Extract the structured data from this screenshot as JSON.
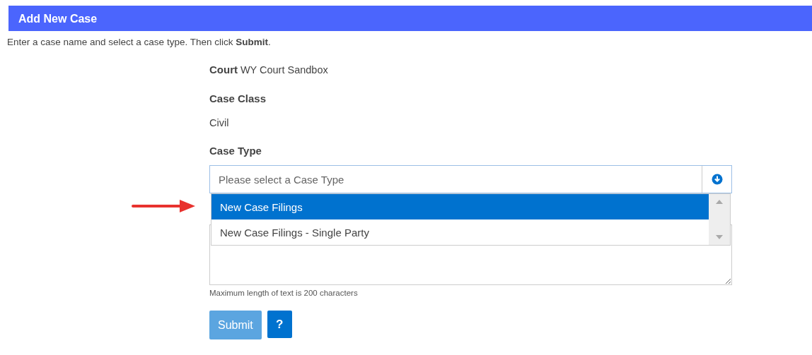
{
  "header": {
    "title": "Add New Case"
  },
  "instructions": "Enter a case name and select a case type. Then click **Submit**.",
  "court": {
    "label": "Court",
    "value": "WY Court Sandbox"
  },
  "case_class": {
    "label": "Case Class",
    "value": "Civil"
  },
  "case_type": {
    "label": "Case Type",
    "placeholder": "Please select a Case Type",
    "expanded": true,
    "options": [
      {
        "label": "New Case Filings",
        "selected": true
      },
      {
        "label": "New Case Filings - Single Party",
        "selected": false
      }
    ]
  },
  "case_name": {
    "hint": "Maximum length of text is 200 characters"
  },
  "buttons": [
    {
      "kind": "submit",
      "label": "Submit",
      "disabled": true
    },
    {
      "kind": "help",
      "label": "?",
      "disabled": false
    }
  ]
}
